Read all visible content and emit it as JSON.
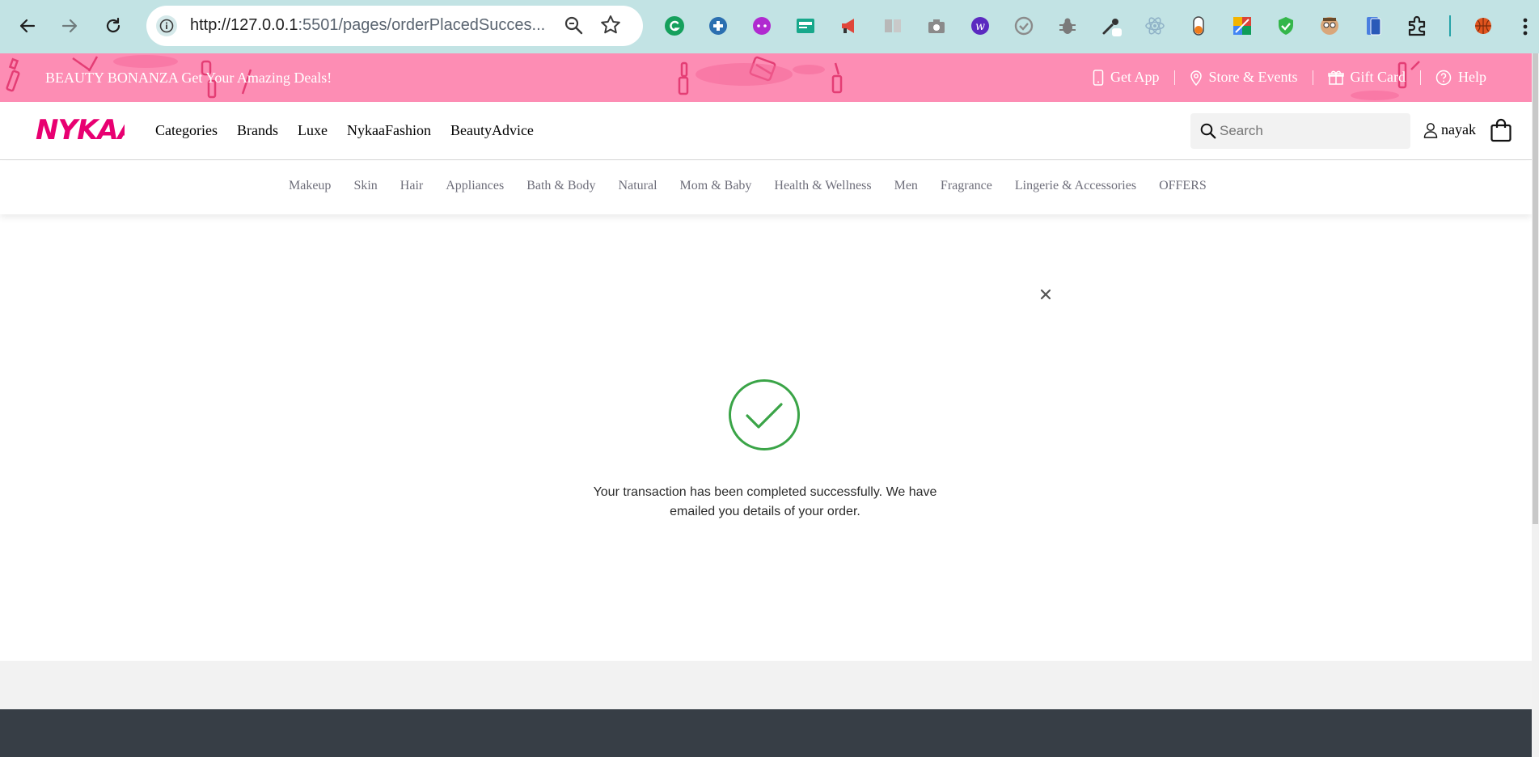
{
  "browser": {
    "url_scheme_host": "http://127.0.0.1",
    "url_rest": ":5501/pages/orderPlacedSucces..."
  },
  "promo": {
    "text": "BEAUTY BONANZA Get Your Amazing Deals!",
    "links": [
      "Get App",
      "Store & Events",
      "Gift Card",
      "Help"
    ]
  },
  "header": {
    "logo_text": "NYKAA",
    "nav": [
      "Categories",
      "Brands",
      "Luxe",
      "NykaaFashion",
      "BeautyAdvice"
    ],
    "search_placeholder": "Search",
    "username": "nayak"
  },
  "categories": [
    "Makeup",
    "Skin",
    "Hair",
    "Appliances",
    "Bath & Body",
    "Natural",
    "Mom & Baby",
    "Health & Wellness",
    "Men",
    "Fragrance",
    "Lingerie & Accessories",
    "OFFERS"
  ],
  "success": {
    "message": "Your transaction has been completed successfully. We have emailed you details of your order."
  },
  "colors": {
    "brand_pink": "#e80071",
    "promo_bg": "#fd8db4",
    "success_green": "#3aa447",
    "footer_bg": "#373e46"
  }
}
